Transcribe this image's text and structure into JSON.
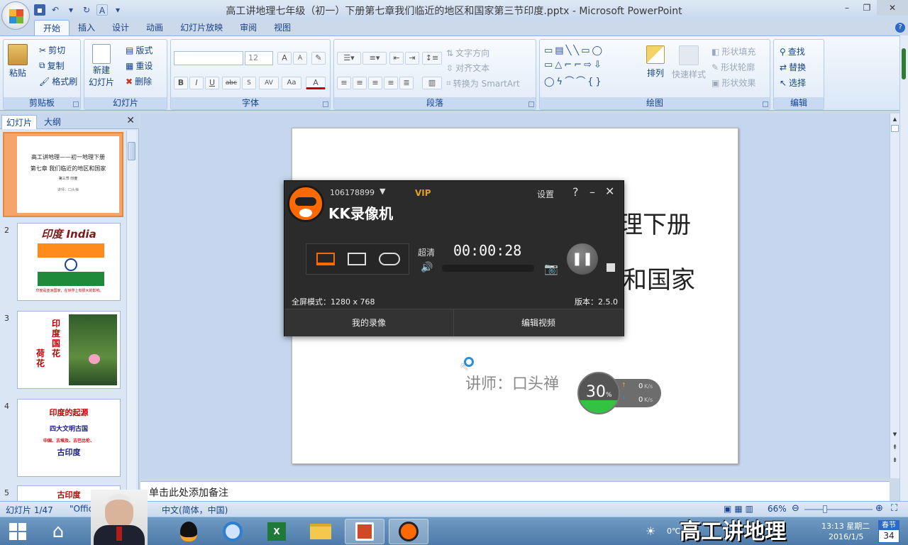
{
  "window": {
    "title": "高工讲地理七年级（初一）下册第七章我们临近的地区和国家第三节印度.pptx - Microsoft PowerPoint",
    "qat_glyph": "A"
  },
  "ribbon_tabs": [
    "开始",
    "插入",
    "设计",
    "动画",
    "幻灯片放映",
    "审阅",
    "视图"
  ],
  "ribbon": {
    "clipboard": {
      "label": "剪贴板",
      "paste": "粘贴",
      "cut": "剪切",
      "copy": "复制",
      "format_painter": "格式刷"
    },
    "slides": {
      "label": "幻灯片",
      "new_slide_line1": "新建",
      "new_slide_line2": "幻灯片",
      "layout": "版式",
      "reset": "重设",
      "delete": "删除"
    },
    "font": {
      "label": "字体",
      "font_size": "12",
      "bold": "B",
      "italic": "I",
      "underline": "U",
      "strike": "abc",
      "spacing": "AV",
      "case": "Aa",
      "color": "A",
      "grow": "A",
      "shrink": "A"
    },
    "paragraph": {
      "label": "段落",
      "text_direction": "文字方向",
      "align_text": "对齐文本",
      "smartart": "转换为 SmartArt"
    },
    "drawing": {
      "label": "绘图",
      "arrange": "排列",
      "quick_styles": "快速样式",
      "shape_fill": "形状填充",
      "shape_outline": "形状轮廓",
      "shape_effects": "形状效果"
    },
    "editing": {
      "label": "编辑",
      "find": "查找",
      "replace": "替换",
      "select": "选择"
    }
  },
  "left_pane": {
    "tab_slides": "幻灯片",
    "tab_outline": "大纲",
    "slides": [
      {
        "num": "1",
        "lines": [
          "高工讲地理——初一地理下册",
          "第七章 我们临近的地区和国家",
          "第三节 印度",
          "讲师：口头禅"
        ]
      },
      {
        "num": "2",
        "title": "印度 India",
        "caption": "印度是亚洲国家，在世界上有很大的影响。"
      },
      {
        "num": "3",
        "title": "印度国花",
        "subtitle": "荷花"
      },
      {
        "num": "4",
        "lines": [
          "印度的起源",
          "四大文明古国",
          "中国、古埃及、古巴比伦、",
          "古印度"
        ]
      },
      {
        "num": "5",
        "title": "古印度"
      }
    ]
  },
  "slide": {
    "line1": "理下册",
    "line2": "和国家",
    "presenter": "讲师：口头禅"
  },
  "notes_placeholder": "单击此处添加备注",
  "statusbar": {
    "slide_count": "幻灯片 1/47",
    "theme": "\"Offic",
    "language": "中文(简体，中国)",
    "zoom": "66%"
  },
  "recorder": {
    "account": "106178899",
    "vip": "VIP",
    "app_name": "KK录像机",
    "settings": "设置",
    "quality": "超清",
    "timer": "00:00:28",
    "mode_text": "全屏模式：1280 x 768",
    "version": "版本：2.5.0",
    "my_recordings": "我的录像",
    "edit_video": "编辑视频"
  },
  "net_widget": {
    "percent": "30",
    "percent_unit": "%",
    "up": "0",
    "down": "0",
    "unit": "K/s"
  },
  "taskbar": {
    "weather": "0℃",
    "time": "13:13 星期二",
    "date": "2016/1/5",
    "calendar_top": "春节",
    "calendar_num": "34"
  },
  "watermark": "高工讲地理",
  "colors": {
    "accent": "#15428b",
    "kk_orange": "#ff6a00",
    "slide_red": "#c00000"
  }
}
